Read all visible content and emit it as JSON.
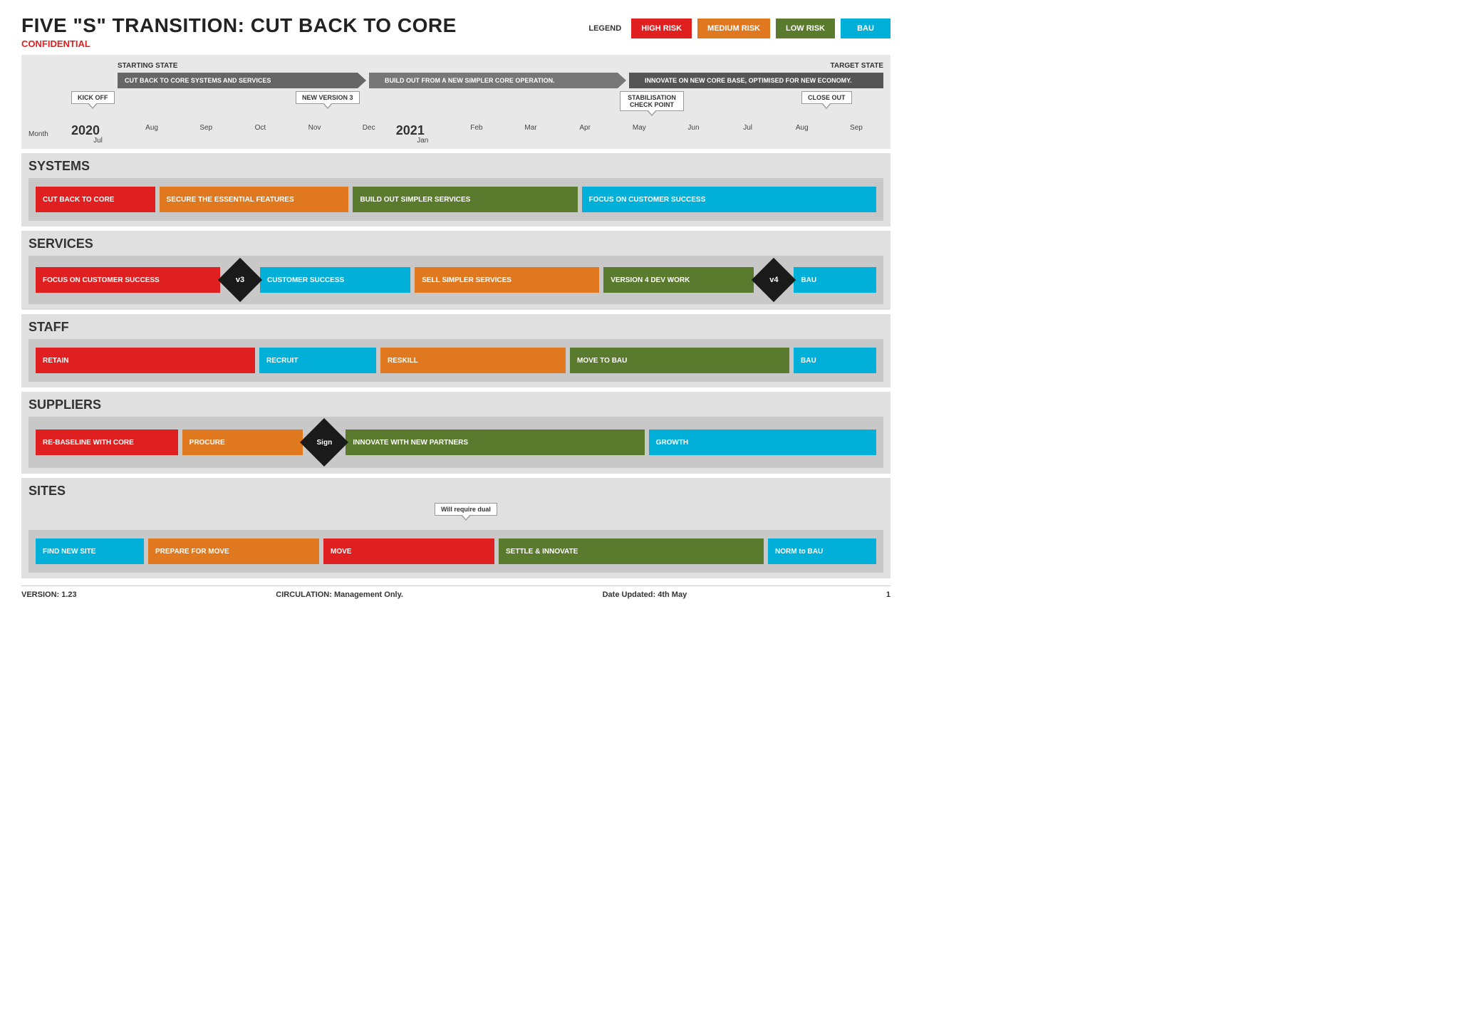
{
  "header": {
    "title": "FIVE \"S\" TRANSITION: CUT BACK TO CORE",
    "confidential": "CONFIDENTIAL"
  },
  "legend": {
    "label": "LEGEND",
    "items": [
      {
        "label": "HIGH RISK",
        "color": "high"
      },
      {
        "label": "MEDIUM RISK",
        "color": "medium"
      },
      {
        "label": "LOW RISK",
        "color": "low"
      },
      {
        "label": "BAU",
        "color": "bau"
      }
    ]
  },
  "timeline": {
    "starting_state": "STARTING STATE",
    "target_state": "TARGET STATE",
    "phases": [
      {
        "label": "CUT BACK TO CORE SYSTEMS AND SERVICES",
        "color": "gray"
      },
      {
        "label": "BUILD OUT FROM A NEW SIMPLER CORE OPERATION.",
        "color": "gray"
      },
      {
        "label": "INNOVATE ON NEW CORE BASE, OPTIMISED FOR NEW ECONOMY.",
        "color": "gray"
      }
    ],
    "callouts": [
      {
        "label": "KICK OFF",
        "position": "early"
      },
      {
        "label": "NEW VERSION 3",
        "position": "mid"
      },
      {
        "label": "STABILISATION CHECK POINT",
        "position": "late"
      },
      {
        "label": "CLOSE OUT",
        "position": "end"
      }
    ],
    "years": [
      "2020",
      "2021"
    ],
    "months": [
      "Month",
      "Jul",
      "Aug",
      "Sep",
      "Oct",
      "Nov",
      "Dec",
      "Jan",
      "Feb",
      "Mar",
      "Apr",
      "May",
      "Jun",
      "Jul",
      "Aug",
      "Sep"
    ]
  },
  "systems": {
    "title": "SYSTEMS",
    "bars": [
      {
        "label": "CUT BACK TO CORE",
        "color": "red",
        "start": 1,
        "span": 2
      },
      {
        "label": "SECURE THE ESSENTIAL FEATURES",
        "color": "orange",
        "start": 3,
        "span": 3
      },
      {
        "label": "BUILD OUT SIMPLER SERVICES",
        "color": "green",
        "start": 6,
        "span": 4
      },
      {
        "label": "FOCUS ON CUSTOMER SUCCESS",
        "color": "blue",
        "start": 10,
        "span": 5
      }
    ]
  },
  "services": {
    "title": "SERVICES",
    "bars": [
      {
        "label": "FOCUS ON CUSTOMER SUCCESS",
        "color": "red",
        "start": 1,
        "span": 3
      },
      {
        "label": "v3",
        "type": "diamond"
      },
      {
        "label": "CUSTOMER SUCCESS",
        "color": "blue",
        "start": 5,
        "span": 2
      },
      {
        "label": "SELL SIMPLER SERVICES",
        "color": "orange",
        "start": 7,
        "span": 3
      },
      {
        "label": "VERSION 4 DEV WORK",
        "color": "green",
        "start": 10,
        "span": 2
      },
      {
        "label": "v4",
        "type": "diamond"
      },
      {
        "label": "BAU",
        "color": "blue",
        "start": 13,
        "span": 1
      }
    ]
  },
  "staff": {
    "title": "STAFF",
    "bars": [
      {
        "label": "RETAIN",
        "color": "red",
        "start": 1,
        "span": 4
      },
      {
        "label": "RECRUIT",
        "color": "blue",
        "start": 5,
        "span": 2
      },
      {
        "label": "RESKILL",
        "color": "orange",
        "start": 7,
        "span": 3
      },
      {
        "label": "MOVE TO BAU",
        "color": "green",
        "start": 10,
        "span": 3
      },
      {
        "label": "BAU",
        "color": "blue",
        "start": 14,
        "span": 1
      }
    ]
  },
  "suppliers": {
    "title": "SUPPLIERS",
    "bars": [
      {
        "label": "RE-BASELINE WITH CORE",
        "color": "red",
        "start": 1,
        "span": 2
      },
      {
        "label": "PROCURE",
        "color": "orange",
        "start": 3,
        "span": 2
      },
      {
        "label": "Sign",
        "type": "diamond"
      },
      {
        "label": "INNOVATE WITH NEW PARTNERS",
        "color": "green",
        "start": 6,
        "span": 5
      },
      {
        "label": "GROWTH",
        "color": "blue",
        "start": 11,
        "span": 4
      }
    ]
  },
  "sites": {
    "title": "SITES",
    "callout": "Will require dual",
    "bars": [
      {
        "label": "FIND NEW SITE",
        "color": "blue",
        "start": 1,
        "span": 2
      },
      {
        "label": "PREPARE FOR MOVE",
        "color": "orange",
        "start": 3,
        "span": 3
      },
      {
        "label": "MOVE",
        "color": "red",
        "start": 6,
        "span": 3
      },
      {
        "label": "SETTLE & INNOVATE",
        "color": "green",
        "start": 9,
        "span": 4
      },
      {
        "label": "NORM to BAU",
        "color": "blue",
        "start": 14,
        "span": 1
      }
    ]
  },
  "footer": {
    "version": "VERSION: 1.23",
    "circulation": "CIRCULATION: Management Only.",
    "date_updated": "Date Updated: 4th May",
    "page": "1"
  }
}
